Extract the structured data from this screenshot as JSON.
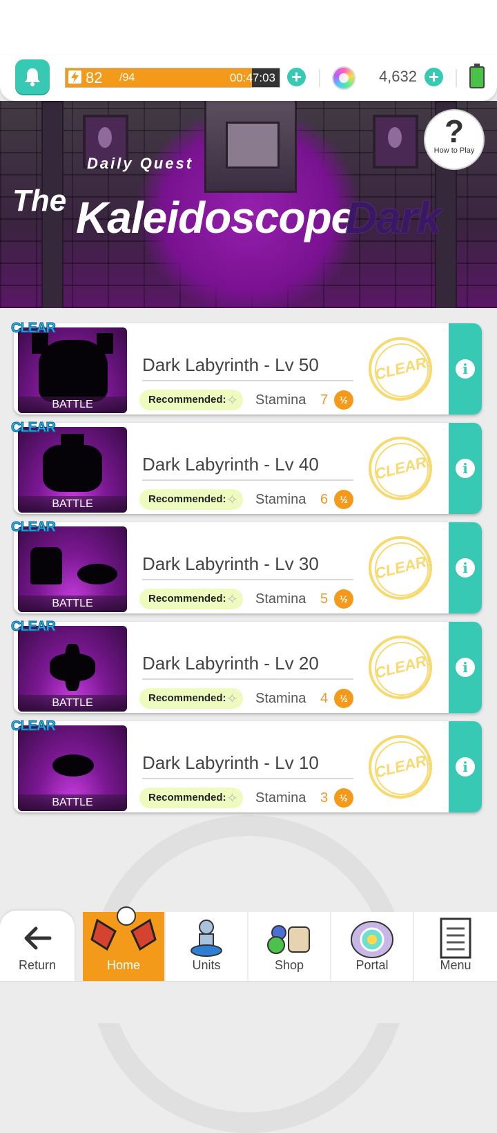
{
  "topbar": {
    "stamina_current": "82",
    "stamina_max": "/94",
    "stamina_fraction": 0.872,
    "stamina_timer": "00:47:03",
    "gem_count": "4,632"
  },
  "banner": {
    "subtitle": "Daily Quest",
    "title_the": "The",
    "title_main": "Kaleidoscope",
    "title_dark": "Dark",
    "how_to_play": "How to Play"
  },
  "quests": [
    {
      "title": "Dark Labyrinth - Lv 50",
      "clear_tag": "CLEAR",
      "thumb_label": "BATTLE",
      "recommended": "Recommended:",
      "stamina_label": "Stamina",
      "stamina_cost": "7",
      "half_badge": "½",
      "stamp": "CLEAR!",
      "info": "i"
    },
    {
      "title": "Dark Labyrinth - Lv 40",
      "clear_tag": "CLEAR",
      "thumb_label": "BATTLE",
      "recommended": "Recommended:",
      "stamina_label": "Stamina",
      "stamina_cost": "6",
      "half_badge": "½",
      "stamp": "CLEAR!",
      "info": "i"
    },
    {
      "title": "Dark Labyrinth - Lv 30",
      "clear_tag": "CLEAR",
      "thumb_label": "BATTLE",
      "recommended": "Recommended:",
      "stamina_label": "Stamina",
      "stamina_cost": "5",
      "half_badge": "½",
      "stamp": "CLEAR!",
      "info": "i"
    },
    {
      "title": "Dark Labyrinth - Lv 20",
      "clear_tag": "CLEAR",
      "thumb_label": "BATTLE",
      "recommended": "Recommended:",
      "stamina_label": "Stamina",
      "stamina_cost": "4",
      "half_badge": "½",
      "stamp": "CLEAR!",
      "info": "i"
    },
    {
      "title": "Dark Labyrinth - Lv 10",
      "clear_tag": "CLEAR",
      "thumb_label": "BATTLE",
      "recommended": "Recommended:",
      "stamina_label": "Stamina",
      "stamina_cost": "3",
      "half_badge": "½",
      "stamp": "CLEAR!",
      "info": "i"
    }
  ],
  "nav": {
    "return": "Return",
    "home": "Home",
    "units": "Units",
    "shop": "Shop",
    "portal": "Portal",
    "menu": "Menu"
  },
  "colors": {
    "accent_teal": "#38c9b4",
    "stamina_orange": "#f49a1a",
    "clear_gold": "#f7d970",
    "banner_purple": "#7b1194"
  },
  "icons": [
    "bell-icon",
    "bolt-icon",
    "plus-icon",
    "gem-icon",
    "battery-icon",
    "question-icon",
    "info-icon",
    "star-icon",
    "arrow-left-icon",
    "home-icon",
    "units-icon",
    "shop-icon",
    "portal-icon",
    "menu-icon"
  ]
}
